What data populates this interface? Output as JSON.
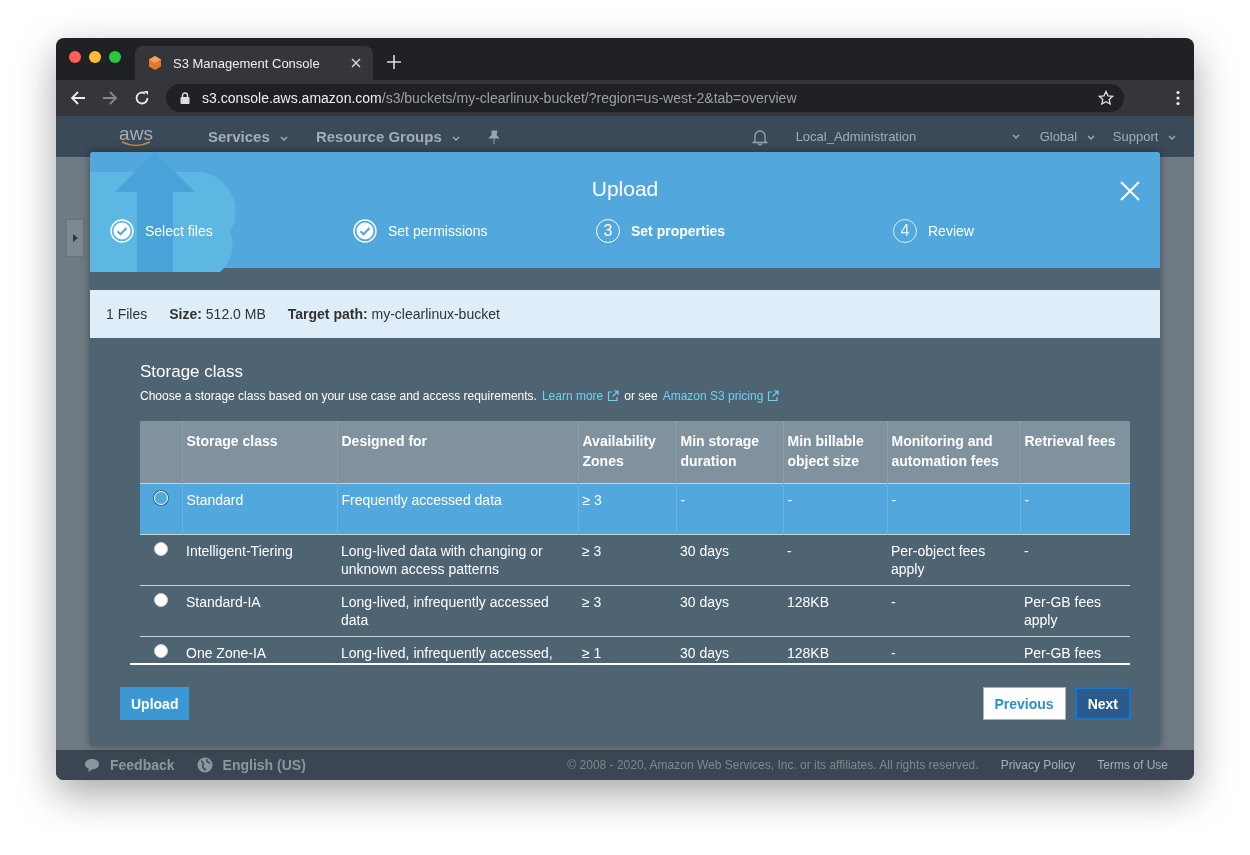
{
  "browser": {
    "tab_title": "S3 Management Console",
    "url_host": "s3.console.aws.amazon.com",
    "url_path": "/s3/buckets/my-clearlinux-bucket/?region=us-west-2&tab=overview"
  },
  "nav": {
    "logo": "aws",
    "items": [
      "Services",
      "Resource Groups"
    ],
    "account": "Local_Administration",
    "region": "Global",
    "support": "Support"
  },
  "modal": {
    "title": "Upload",
    "steps": [
      {
        "label": "Select files",
        "done": true,
        "current": false
      },
      {
        "label": "Set permissions",
        "done": true,
        "current": false
      },
      {
        "number": "3",
        "label": "Set properties",
        "done": false,
        "current": true
      },
      {
        "number": "4",
        "label": "Review",
        "done": false,
        "current": false
      }
    ],
    "info": {
      "files": "1 Files",
      "size_label": "Size:",
      "size": "512.0 MB",
      "path_label": "Target path:",
      "path": "my-clearlinux-bucket"
    },
    "section_title": "Storage class",
    "description": "Choose a storage class based on your use case and access requirements.",
    "learn_more": "Learn more",
    "or_see": "or see",
    "pricing_link": "Amazon S3 pricing",
    "table": {
      "columns": [
        "Storage class",
        "Designed for",
        "Availability Zones",
        "Min storage duration",
        "Min billable object size",
        "Monitoring and automation fees",
        "Retrieval fees"
      ],
      "rows": [
        {
          "selected": true,
          "cells": [
            "Standard",
            "Frequently accessed data",
            "≥ 3",
            "-",
            "-",
            "-",
            "-"
          ]
        },
        {
          "selected": false,
          "cells": [
            "Intelligent-Tiering",
            "Long-lived data with changing or unknown access patterns",
            "≥ 3",
            "30 days",
            "-",
            "Per-object fees apply",
            "-"
          ]
        },
        {
          "selected": false,
          "cells": [
            "Standard-IA",
            "Long-lived, infrequently accessed data",
            "≥ 3",
            "30 days",
            "128KB",
            "-",
            "Per-GB fees apply"
          ]
        },
        {
          "selected": false,
          "cells": [
            "One Zone-IA",
            "Long-lived, infrequently accessed,",
            "≥ 1",
            "30 days",
            "128KB",
            "-",
            "Per-GB fees"
          ]
        }
      ]
    },
    "upload_button": "Upload",
    "previous_button": "Previous",
    "next_button": "Next"
  },
  "footer": {
    "feedback": "Feedback",
    "language": "English (US)",
    "copyright": "© 2008 - 2020, Amazon Web Services, Inc. or its affiliates. All rights reserved.",
    "links": [
      "Privacy Policy",
      "Terms of Use"
    ]
  }
}
